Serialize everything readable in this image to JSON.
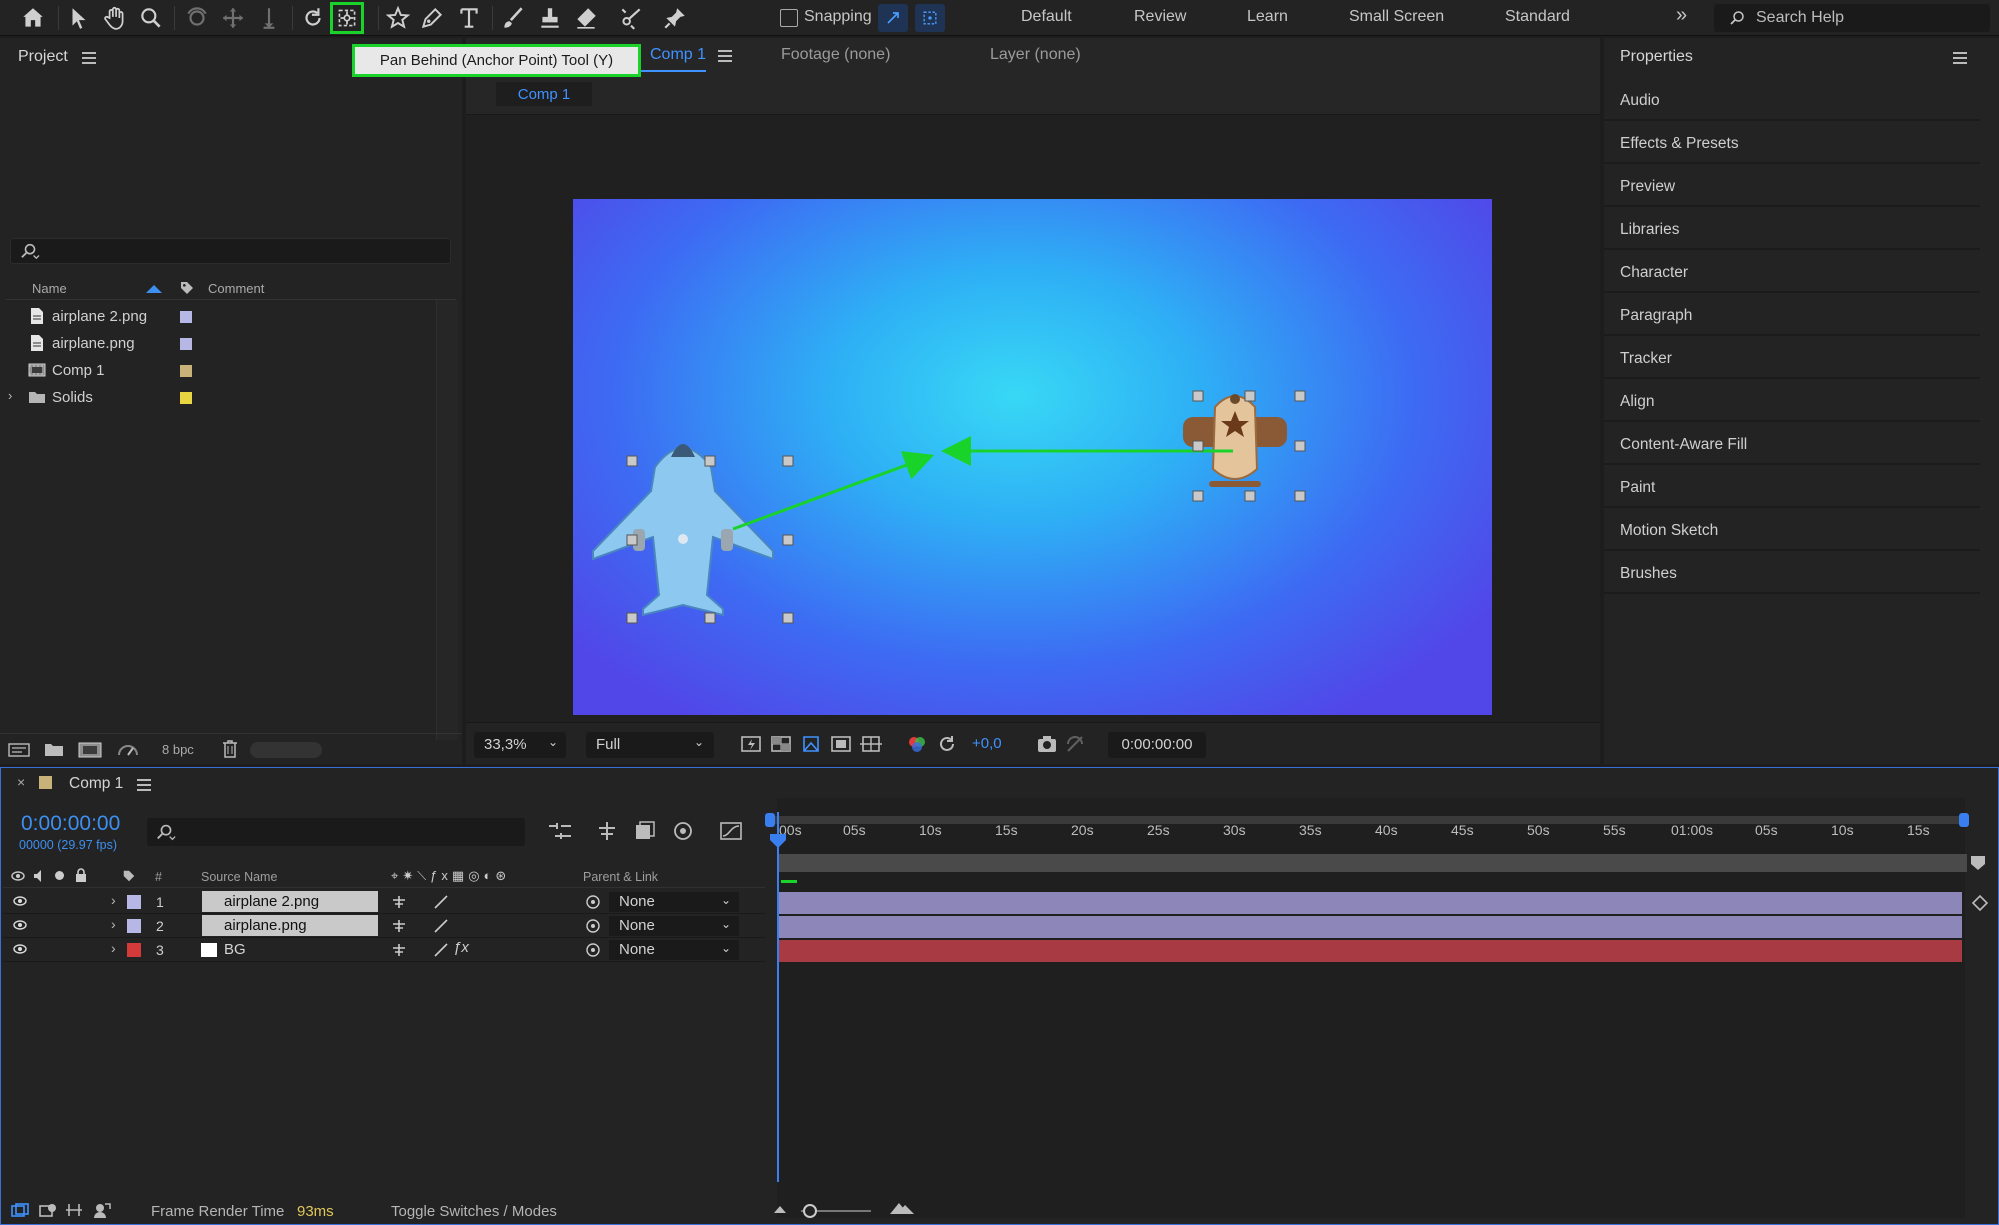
{
  "toolbar": {
    "tools": [
      "home-icon",
      "selection-tool-icon",
      "hand-tool-icon",
      "zoom-tool-icon",
      "orbit-camera-tool-icon",
      "pan-camera-tool-icon",
      "dolly-camera-tool-icon",
      "rotation-tool-icon",
      "pan-behind-tool-icon",
      "shape-tool-icon",
      "pen-tool-icon",
      "type-tool-icon",
      "brush-tool-icon",
      "clone-stamp-tool-icon",
      "eraser-tool-icon",
      "roto-brush-tool-icon",
      "puppet-pin-tool-icon"
    ],
    "active_tool": "pan-behind-tool-icon",
    "accent": "#19d32a",
    "snapping_label": "Snapping",
    "workspaces": [
      "Default",
      "Review",
      "Learn",
      "Small Screen",
      "Standard"
    ],
    "search_placeholder": "Search Help"
  },
  "tooltip": {
    "text": "Pan Behind (Anchor Point) Tool (Y)"
  },
  "project_panel": {
    "title": "Project",
    "columns": {
      "name": "Name",
      "comment": "Comment"
    },
    "items": [
      {
        "name": "airplane 2.png",
        "type": "footage",
        "label_color": "#b7b7e6"
      },
      {
        "name": "airplane.png",
        "type": "footage",
        "label_color": "#b7b7e6"
      },
      {
        "name": "Comp 1",
        "type": "composition",
        "label_color": "#c9b27a"
      },
      {
        "name": "Solids",
        "type": "folder",
        "label_color": "#e8d542"
      }
    ],
    "bpc": "8 bpc"
  },
  "viewer": {
    "tabs": {
      "composition": "Comp 1",
      "footage": "Footage (none)",
      "layer": "Layer (none)"
    },
    "subtab": "Comp 1",
    "zoom": "33,3%",
    "resolution": "Full",
    "exposure": "+0,0",
    "timecode": "0:00:00:00"
  },
  "properties_panel": {
    "title": "Properties",
    "items": [
      "Audio",
      "Effects & Presets",
      "Preview",
      "Libraries",
      "Character",
      "Paragraph",
      "Tracker",
      "Align",
      "Content-Aware Fill",
      "Paint",
      "Motion Sketch",
      "Brushes"
    ]
  },
  "timeline": {
    "tab": "Comp 1",
    "current_time": "0:00:00:00",
    "frame_info": "00000 (29.97 fps)",
    "columns": {
      "num": "#",
      "source": "Source Name",
      "parent": "Parent & Link"
    },
    "ruler_labels": [
      "00s",
      "05s",
      "10s",
      "15s",
      "20s",
      "25s",
      "30s",
      "35s",
      "40s",
      "45s",
      "50s",
      "55s",
      "01:00s",
      "05s",
      "10s",
      "15s"
    ],
    "layers": [
      {
        "num": "1",
        "name": "airplane 2.png",
        "label_color": "#b7b7e6",
        "parent": "None",
        "bar_color": "#8d86b9",
        "has_fx": false
      },
      {
        "num": "2",
        "name": "airplane.png",
        "label_color": "#b7b7e6",
        "parent": "None",
        "bar_color": "#8d86b9",
        "has_fx": false
      },
      {
        "num": "3",
        "name": "BG",
        "label_color": "#d43a3a",
        "parent": "None",
        "bar_color": "#a83a44",
        "has_fx": true
      }
    ],
    "footer": {
      "render_label": "Frame Render Time",
      "render_value": "93ms",
      "toggle": "Toggle Switches / Modes"
    }
  }
}
